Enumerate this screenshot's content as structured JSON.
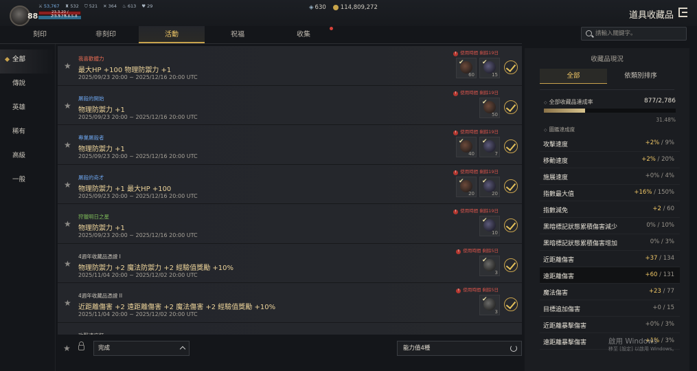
{
  "player": {
    "level": "88",
    "hp_text": "23.3.20 / 20.3.20",
    "mp_text": "2.3.9 / 8.8.5.8"
  },
  "top_stats": [
    {
      "icon": "sword",
      "value": "53,767"
    },
    {
      "icon": "armor",
      "value": "532"
    },
    {
      "icon": "shield",
      "value": "521"
    },
    {
      "icon": "cross",
      "value": "364"
    },
    {
      "icon": "fire",
      "value": "613"
    },
    {
      "icon": "heart",
      "value": "29"
    }
  ],
  "currency": {
    "gems": "630",
    "gold": "114,809,272"
  },
  "page_title": "道具收藏品",
  "tabs": [
    {
      "label": "刻印"
    },
    {
      "label": "非刻印"
    },
    {
      "label": "活動"
    },
    {
      "label": "祝福"
    },
    {
      "label": "收集"
    }
  ],
  "search": {
    "placeholder": "請輸入關鍵字。"
  },
  "categories": [
    {
      "label": "全部"
    },
    {
      "label": "傳說"
    },
    {
      "label": "英雄"
    },
    {
      "label": "稀有"
    },
    {
      "label": "高級"
    },
    {
      "label": "一般"
    }
  ],
  "rows": [
    {
      "name": "我喜歡體力",
      "name_color": "#e26a52",
      "effect": "最大HP +100 物理防禦力 +1",
      "period": "2025/09/23 20:00 ~ 2025/12/16 20:00 UTC",
      "expiry": "使用時間 剩餘19日",
      "slots": [
        {
          "orb": "r",
          "count": "60"
        },
        {
          "orb": "b",
          "count": "15"
        }
      ]
    },
    {
      "name": "屠殺的開始",
      "name_color": "#6aa0e6",
      "effect": "物理防禦力 +1",
      "period": "2025/09/23 20:00 ~ 2025/12/16 20:00 UTC",
      "expiry": "使用時間 剩餘19日",
      "slots": [
        {
          "orb": "r",
          "count": "50"
        }
      ]
    },
    {
      "name": "專業屠殺者",
      "name_color": "#6aa0e6",
      "effect": "物理防禦力 +1",
      "period": "2025/09/23 20:00 ~ 2025/12/16 20:00 UTC",
      "expiry": "使用時間 剩餘19日",
      "slots": [
        {
          "orb": "r",
          "count": "40"
        },
        {
          "orb": "b",
          "count": "7"
        }
      ]
    },
    {
      "name": "屠殺的奇才",
      "name_color": "#6aa0e6",
      "effect": "物理防禦力 +1 最大HP +100",
      "period": "2025/09/23 20:00 ~ 2025/12/16 20:00 UTC",
      "expiry": "使用時間 剩餘19日",
      "slots": [
        {
          "orb": "r",
          "count": "20"
        },
        {
          "orb": "b",
          "count": "20"
        }
      ]
    },
    {
      "name": "狩獵明日之星",
      "name_color": "#7fbd5a",
      "effect": "物理防禦力 +1",
      "period": "2025/09/23 20:00 ~ 2025/12/16 20:00 UTC",
      "expiry": "使用時間 剩餘19日",
      "slots": [
        {
          "orb": "b",
          "count": "10"
        }
      ]
    },
    {
      "name": "4週年收藏品憑證 I",
      "name_color": "#c8c3b9",
      "effect": "物理防禦力 +2 魔法防禦力 +2 經驗值獎勵 +10%",
      "period": "2025/11/04 20:00 ~ 2025/12/02 20:00 UTC",
      "expiry": "使用時間 剩餘5日",
      "slots": [
        {
          "orb": "g",
          "count": "3"
        }
      ]
    },
    {
      "name": "4週年收藏品憑證 II",
      "name_color": "#c8c3b9",
      "effect": "近距離傷害 +2 遠距離傷害 +2 魔法傷害 +2 經驗值獎勵 +10%",
      "period": "2025/11/04 20:00 ~ 2025/12/02 20:00 UTC",
      "expiry": "使用時間 剩餘5日",
      "slots": [
        {
          "orb": "g",
          "count": "3"
        }
      ]
    },
    {
      "name": "攻擊速度狂",
      "name_color": "#c8c3b9",
      "effect": "",
      "period": "",
      "expiry": "",
      "slots": []
    }
  ],
  "bottom": {
    "status_select": "完成",
    "filter": "能力值4種"
  },
  "panel": {
    "title": "收藏品現況",
    "tabs": [
      {
        "label": "全部"
      },
      {
        "label": "依類別排序"
      }
    ],
    "total_label": "全部收藏品達成率",
    "total_value": "877/2,786",
    "total_ratio": 0.3148,
    "total_pct": "31.48%",
    "section_label": "圖鑑達成度",
    "stats": [
      {
        "label": "攻擊速度",
        "gain": "+2%",
        "max": "9%"
      },
      {
        "label": "移動速度",
        "gain": "+2%",
        "max": "20%"
      },
      {
        "label": "施展速度",
        "gain": "+0%",
        "max": "4%"
      },
      {
        "label": "指數最大值",
        "gain": "+16%",
        "max": "150%"
      },
      {
        "label": "指數減免",
        "gain": "+2",
        "max": "60"
      },
      {
        "label": "黑暗標記狀態累積傷害減少",
        "gain": "0%",
        "max": "10%"
      },
      {
        "label": "黑暗標記狀態累積傷害增加",
        "gain": "0%",
        "max": "3%"
      },
      {
        "label": "近距離傷害",
        "gain": "+37",
        "max": "134"
      },
      {
        "label": "遠距離傷害",
        "gain": "+60",
        "max": "131"
      },
      {
        "label": "魔法傷害",
        "gain": "+23",
        "max": "77"
      },
      {
        "label": "目標追加傷害",
        "gain": "+0",
        "max": "15"
      },
      {
        "label": "近距離暴擊傷害",
        "gain": "+0%",
        "max": "3%"
      },
      {
        "label": "遠距離暴擊傷害",
        "gain": "+1%",
        "max": "3%"
      }
    ]
  },
  "watermark": {
    "line1": "啟用 Windows",
    "line2": "移至 [設定] 以啟用 Windows。"
  }
}
